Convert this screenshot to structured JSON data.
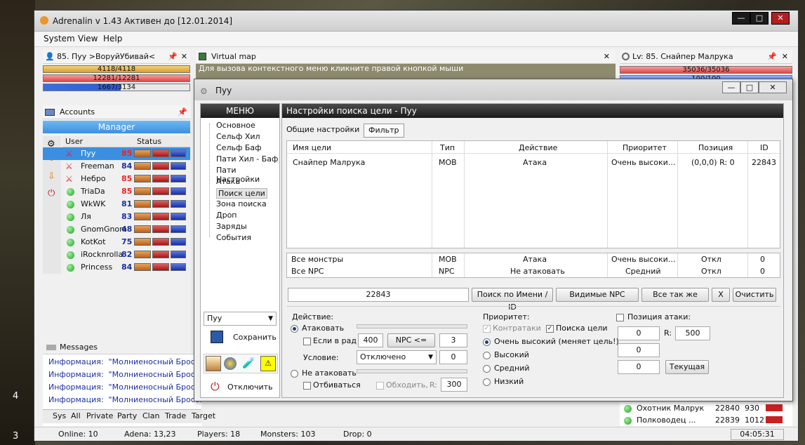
{
  "app": {
    "title": "Adrenalin v 1.43  Активен до [12.01.2014]",
    "menu": [
      "System",
      "View",
      "Help"
    ],
    "window_buttons": [
      "—",
      "□",
      "✕"
    ]
  },
  "char_panel": {
    "title": "85. Пуу  >ВоруйУбивай<",
    "hp": "4118/4118",
    "mp": "12281/12281",
    "cp": "1667/3134"
  },
  "map_panel": {
    "title": "Virtual map",
    "hint": "Для вызова контекстного меню кликните правой кнопкой мыши"
  },
  "target_panel": {
    "title": "Lv: 85. Снайпер Малрука",
    "hp": "35036/35036",
    "mp": "100/100"
  },
  "accounts": {
    "title": "Accounts",
    "manager": "Manager",
    "col_user": "User",
    "col_status": "Status",
    "users": [
      {
        "name": "Пуу",
        "level": "85"
      },
      {
        "name": "Freeman",
        "level": "84"
      },
      {
        "name": "Небро",
        "level": "85"
      },
      {
        "name": "TriaDa",
        "level": "85"
      },
      {
        "name": "WkWK",
        "level": "81"
      },
      {
        "name": "Ля",
        "level": "83"
      },
      {
        "name": "GnomGnom",
        "level": "48"
      },
      {
        "name": "KotKot",
        "level": "75"
      },
      {
        "name": "iRocknrolla",
        "level": "82"
      },
      {
        "name": "Princess",
        "level": "84"
      }
    ]
  },
  "messages": {
    "title": "Messages",
    "lines": [
      {
        "type": "Информация:",
        "text": "\"Молниеносный Бросок"
      },
      {
        "type": "Информация:",
        "text": "\"Молниеносный Бросок"
      },
      {
        "type": "Информация:",
        "text": "\"Молниеносный Бросок"
      },
      {
        "type": "Информация:",
        "text": "\"Молниеносный Бросок"
      }
    ],
    "tabs": [
      "Sys",
      "All",
      "Private",
      "Party",
      "Clan",
      "Trade",
      "Target"
    ]
  },
  "right_list": [
    {
      "name": "Охотник Малрук",
      "id": "22840",
      "val": "930"
    },
    {
      "name": "Полководец ...",
      "id": "22839",
      "val": "1012"
    }
  ],
  "statusbar": {
    "online": "Online: 10",
    "adena": "Adena: 13,23",
    "players": "Players: 18",
    "monsters": "Monsters: 103",
    "drop": "Drop: 0",
    "time": "04:05:31"
  },
  "dialog": {
    "title": "Пуу",
    "menu_header": "МЕНЮ",
    "menu_items": [
      "Основное",
      "Сельф Хил",
      "Сельф Баф",
      "Пати Хил - Баф",
      "Пати Настройки",
      "Атака",
      "Поиск цели",
      "Зона поиска",
      "Дроп",
      "Заряды",
      "События"
    ],
    "char_select": "Пуу",
    "save": "Сохранить",
    "disconnect": "Отключить",
    "content_header": "Настройки поиска цели  -  Пуу",
    "tabs": [
      "Общие настройки",
      "Фильтр"
    ],
    "table_headers": [
      "Имя цели",
      "Тип",
      "Действие",
      "Приоритет",
      "Позиция",
      "ID"
    ],
    "rows": [
      [
        "Снайпер Малрука",
        "MOB",
        "Атака",
        "Очень высоки...",
        "(0,0,0) R: 0",
        "22843"
      ]
    ],
    "default_rows": [
      [
        "Все монстры",
        "MOB",
        "Атака",
        "Очень высоки...",
        "Откл",
        "0"
      ],
      [
        "Все NPC",
        "NPC",
        "Не атаковать",
        "Средний",
        "Откл",
        "0"
      ]
    ],
    "search_value": "22843",
    "buttons": {
      "search_name": "Поиск по Имени / ID",
      "visible_npc": "Видимые NPC",
      "all_same": "Все так же",
      "x": "X",
      "clear": "Очистить"
    },
    "action": {
      "label": "Действие:",
      "attack": "Атаковать",
      "if_in_range": "Если в рад",
      "range": "400",
      "npc_btn": "NPC  <=",
      "npc_count": "3",
      "condition_label": "Условие:",
      "condition": "Отключено",
      "condition_val": "0",
      "no_attack": "Не атаковать",
      "fight_back": "Отбиваться",
      "bypass": "Обходить,",
      "r_label": "R:",
      "bypass_r": "300"
    },
    "priority": {
      "label": "Приоритет:",
      "counter": "Контратаки",
      "search_targets": "Поиска цели",
      "options": [
        "Очень высокий (меняет цель!)",
        "Высокий",
        "Средний",
        "Низкий"
      ]
    },
    "position": {
      "label": "Позиция атаки:",
      "x": "0",
      "r_label": "R:",
      "r": "500",
      "y": "0",
      "z": "0",
      "current": "Текущая"
    }
  },
  "side_numbers": [
    "4",
    "3"
  ]
}
